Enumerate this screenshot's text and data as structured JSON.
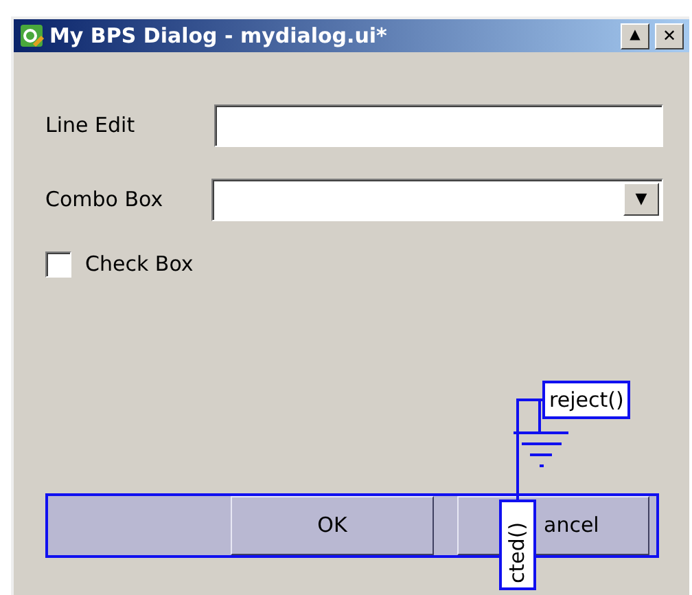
{
  "window": {
    "title": "My BPS Dialog - mydialog.ui*",
    "controls": [
      {
        "kind": "maximize",
        "label": "▲"
      },
      {
        "kind": "close",
        "label": "✕"
      }
    ]
  },
  "form": [
    {
      "kind": "line_edit",
      "label": "Line Edit"
    },
    {
      "kind": "combo",
      "label": "Combo Box",
      "arrow": "▼"
    },
    {
      "kind": "checkbox",
      "label": "Check Box",
      "checked": false
    }
  ],
  "buttons": [
    {
      "label": "OK"
    },
    {
      "label": "ancel"
    }
  ],
  "connection": {
    "signal": "cted()",
    "slot": "reject()"
  }
}
